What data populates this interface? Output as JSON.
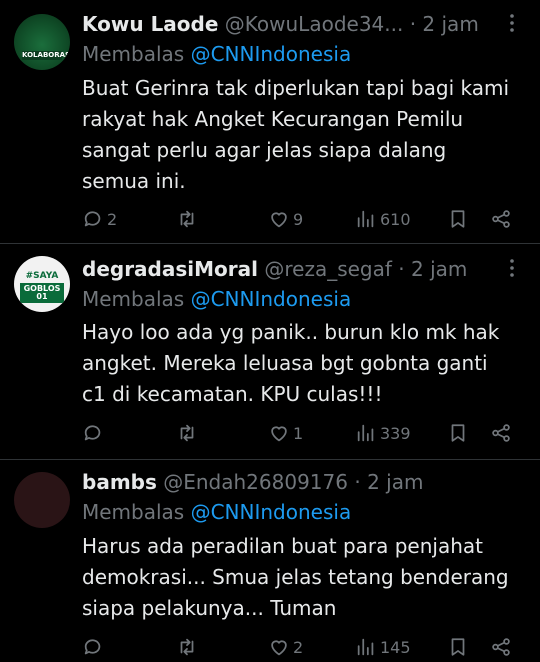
{
  "tweets": [
    {
      "name": "Kowu Laode",
      "handle": "@KowuLaode34...",
      "dot": "·",
      "time": "2 jam",
      "reply_prefix": "Membalas",
      "reply_to": "@CNNIndonesia",
      "lines": [
        "Buat Gerinra tak diperlukan tapi bagi kami",
        "rakyat hak Angket Kecurangan Pemilu",
        "sangat perlu agar jelas siapa dalang",
        "semua ini."
      ],
      "avatar_text": "KOLABORASI",
      "replies": "2",
      "retweets": "",
      "likes": "9",
      "views": "610"
    },
    {
      "name": "degradasiMoral",
      "handle": "@reza_segaf",
      "dot": "·",
      "time": "2 jam",
      "reply_prefix": "Membalas",
      "reply_to": "@CNNIndonesia",
      "lines": [
        "Hayo loo ada yg panik.. burun klo mk hak",
        "angket. Mereka leluasa bgt gobnta ganti",
        "c1 di kecamatan. KPU culas!!!"
      ],
      "avatar_text": "#SAYA",
      "avatar_text2": "GOBLOS 01",
      "replies": "",
      "retweets": "",
      "likes": "1",
      "views": "339"
    },
    {
      "name": "bambs",
      "handle": "@Endah26809176",
      "dot": "·",
      "time": "2 jam",
      "reply_prefix": "Membalas",
      "reply_to": "@CNNIndonesia",
      "lines": [
        "Harus ada peradilan buat para penjahat",
        "demokrasi... Smua jelas tetang benderang",
        "siapa pelakunya... Tuman"
      ],
      "replies": "",
      "retweets": "",
      "likes": "2",
      "views": "145"
    }
  ],
  "colors": {
    "background": "#000000",
    "text": "#e7e9ea",
    "muted": "#71767b",
    "link": "#1d9bf0",
    "divider": "#2f3336"
  }
}
